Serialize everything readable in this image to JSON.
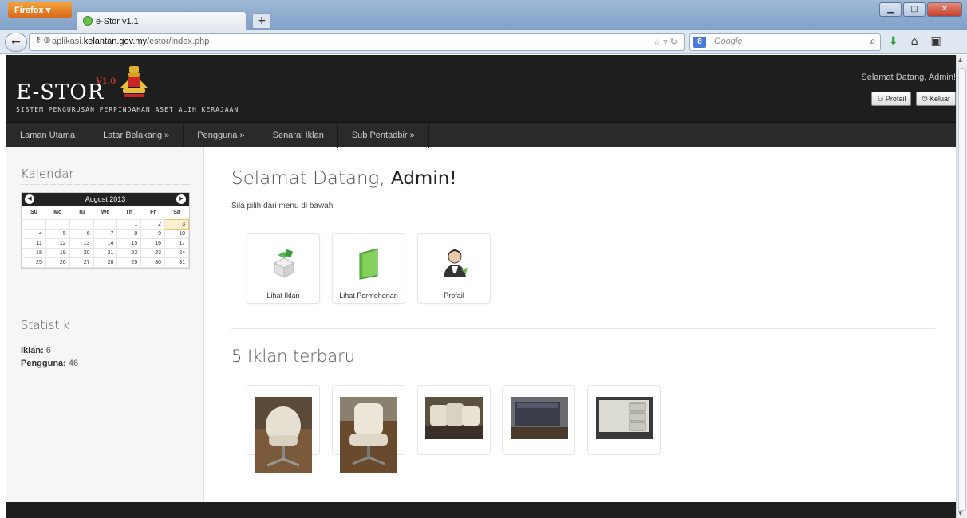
{
  "browser": {
    "firefox_label": "Firefox",
    "tab_title": "e-Stor v1.1",
    "new_tab": "+",
    "url_prefix": "aplikasi.",
    "url_domain": "kelantan.gov.my",
    "url_path": "/estor/index.php",
    "search_placeholder": "Google",
    "search_engine_letter": "8"
  },
  "header": {
    "logo": "E-STOR",
    "version": "V1.0",
    "tagline": "SISTEM PENGURUSAN PERPINDAHAN ASET ALIH KERAJAAN",
    "welcome": "Selamat Datang, Admin!",
    "profile_btn": "Profail",
    "logout_btn": "Keluar"
  },
  "menu": [
    {
      "label": "Laman Utama"
    },
    {
      "label": "Latar Belakang »"
    },
    {
      "label": "Pengguna »"
    },
    {
      "label": "Senarai Iklan"
    },
    {
      "label": "Sub Pentadbir »"
    }
  ],
  "sidebar": {
    "calendar_title": "Kalendar",
    "month": "August 2013",
    "weekdays": [
      "Su",
      "Mo",
      "Tu",
      "We",
      "Th",
      "Fr",
      "Sa"
    ],
    "weeks": [
      [
        "",
        "",
        "",
        "",
        "1",
        "2",
        "3"
      ],
      [
        "4",
        "5",
        "6",
        "7",
        "8",
        "9",
        "10"
      ],
      [
        "11",
        "12",
        "13",
        "14",
        "15",
        "16",
        "17"
      ],
      [
        "18",
        "19",
        "20",
        "21",
        "22",
        "23",
        "24"
      ],
      [
        "25",
        "26",
        "27",
        "28",
        "29",
        "30",
        "31"
      ]
    ],
    "today": "3",
    "stats_title": "Statistik",
    "iklan_label": "Iklan:",
    "iklan_value": "6",
    "pengguna_label": "Pengguna:",
    "pengguna_value": "46"
  },
  "main": {
    "greeting_prefix": "Selamat Datang, ",
    "greeting_name": "Admin!",
    "subtitle": "Sila pilih dari menu di bawah,",
    "tiles": [
      {
        "label": "Lihat Iklan",
        "icon": "boxes-icon"
      },
      {
        "label": "Lihat Permohonan",
        "icon": "green-folder-icon"
      },
      {
        "label": "Profail",
        "icon": "user-profile-icon"
      }
    ],
    "latest_title": "5 Iklan terbaru"
  },
  "colors": {
    "header_bg": "#1e1e1e",
    "menu_bg": "#2a2a2a",
    "version_red": "#c0392b"
  }
}
